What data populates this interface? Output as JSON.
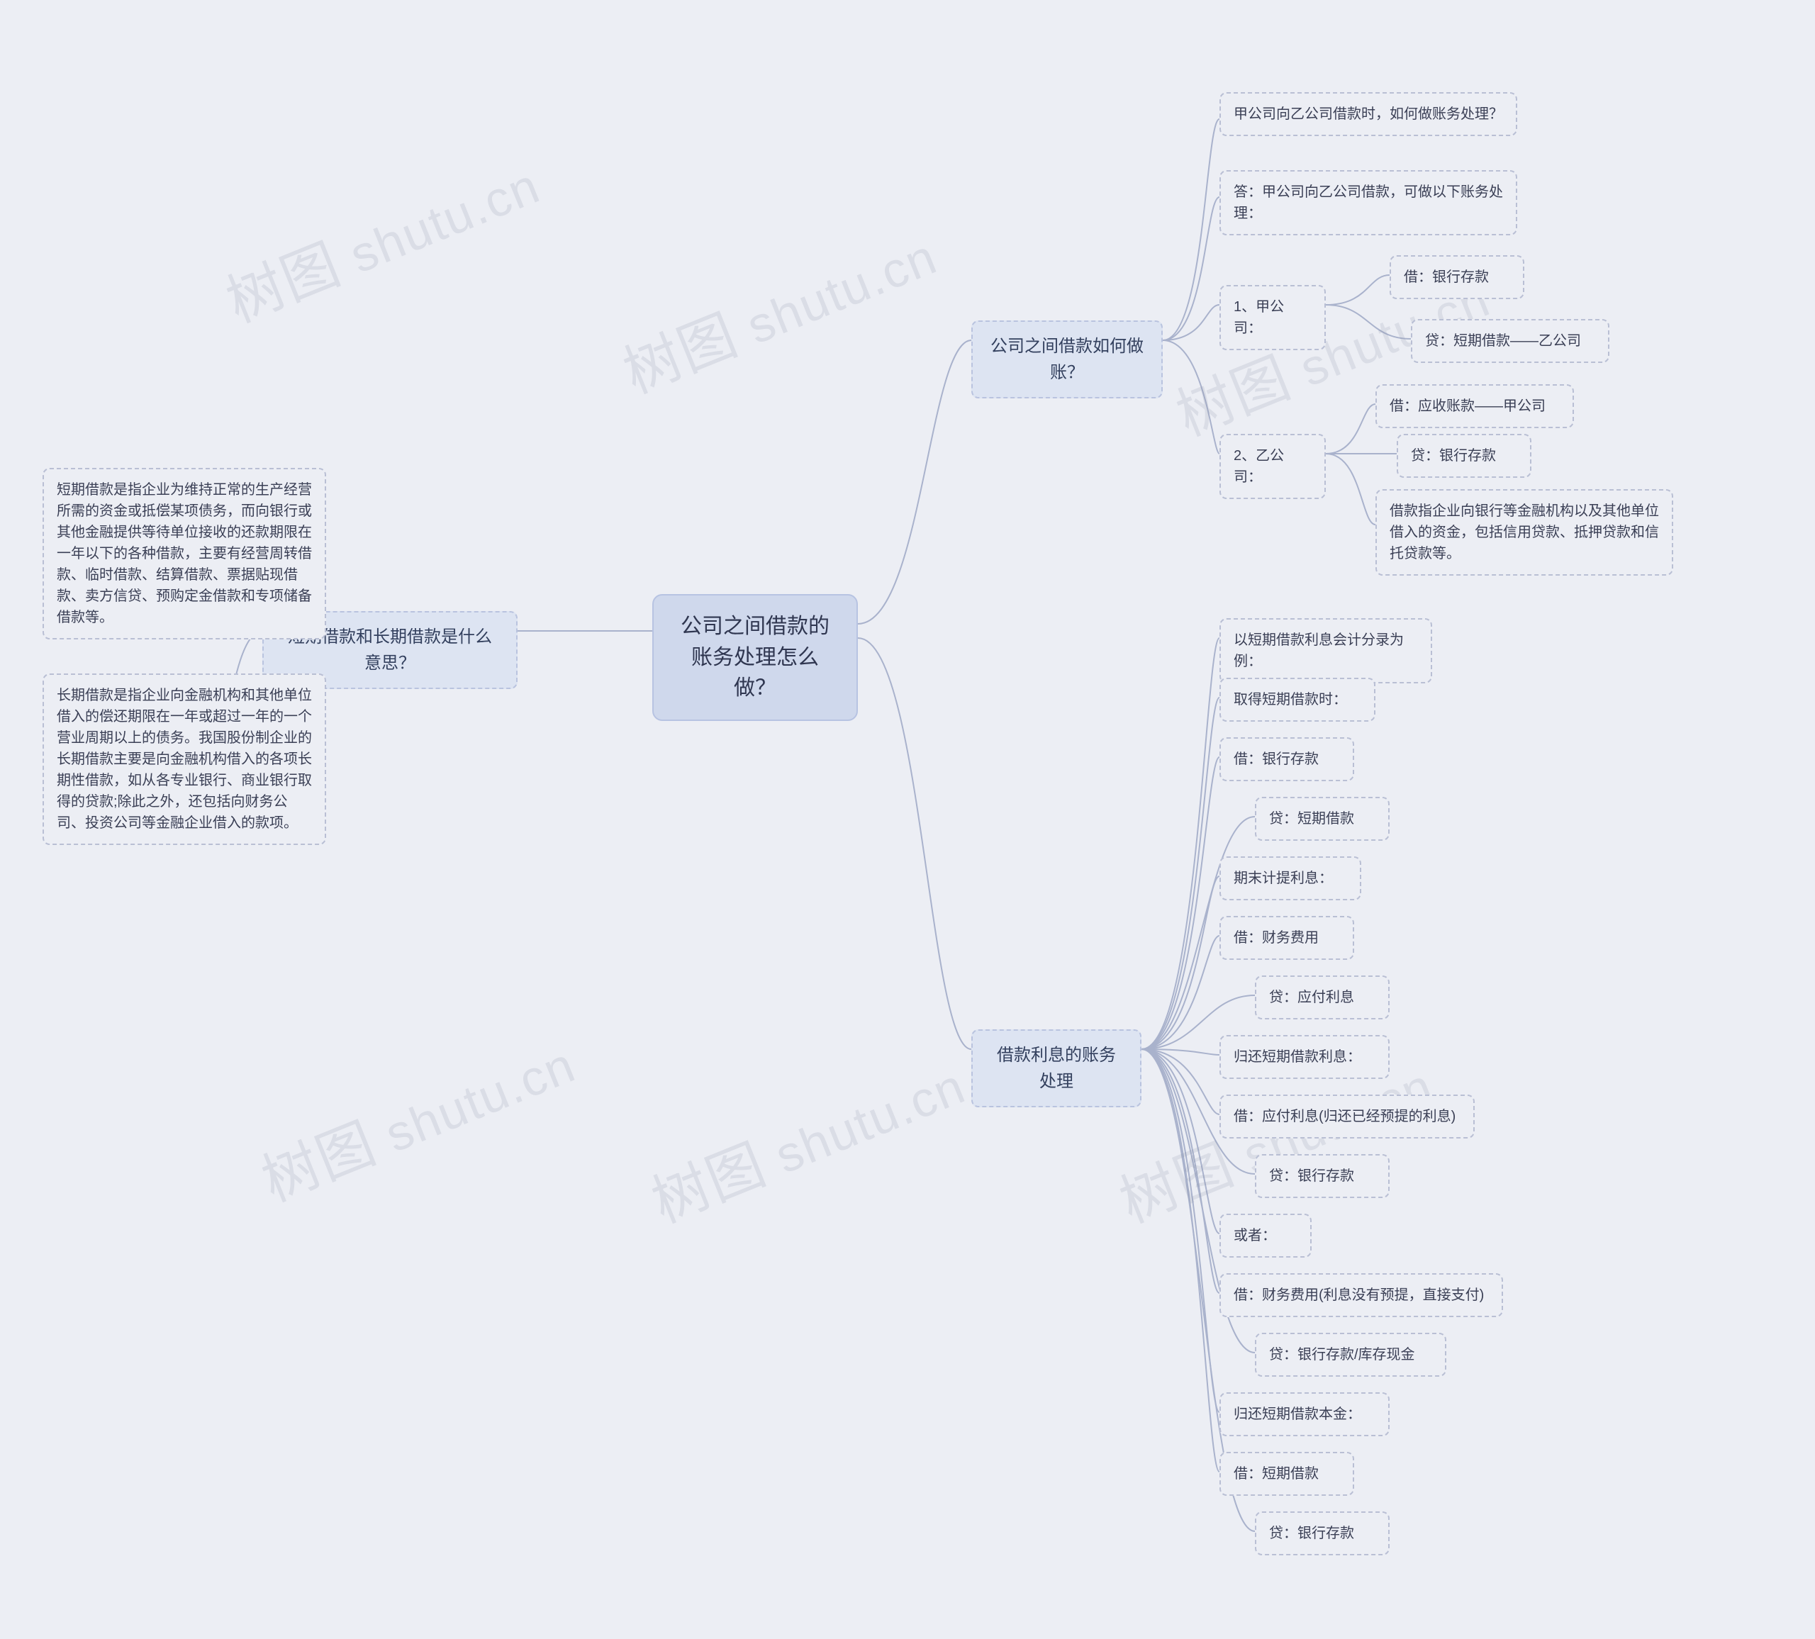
{
  "root": {
    "title": "公司之间借款的账务处理怎么做？"
  },
  "left": {
    "branch1": {
      "label": "短期借款和长期借款是什么意思？",
      "items": [
        "短期借款是指企业为维持正常的生产经营所需的资金或抵偿某项债务，而向银行或其他金融提供等待单位接收的还款期限在一年以下的各种借款，主要有经营周转借款、临时借款、结算借款、票据贴现借款、卖方信贷、预购定金借款和专项储备借款等。",
        "长期借款是指企业向金融机构和其他单位借入的偿还期限在一年或超过一年的一个营业周期以上的债务。我国股份制企业的长期借款主要是向金融机构借入的各项长期性借款，如从各专业银行、商业银行取得的贷款;除此之外，还包括向财务公司、投资公司等金融企业借入的款项。"
      ]
    }
  },
  "right": {
    "branch1": {
      "label": "公司之间借款如何做账？",
      "items": {
        "q": "甲公司向乙公司借款时，如何做账务处理？",
        "a": "答：甲公司向乙公司借款，可做以下账务处理：",
        "c1_label": "1、甲公司：",
        "c1_d": "借：银行存款",
        "c1_c": "贷：短期借款——乙公司",
        "c2_label": "2、乙公司：",
        "c2_d": "借：应收账款——甲公司",
        "c2_c": "贷：银行存款",
        "c2_n": "借款指企业向银行等金融机构以及其他单位借入的资金，包括信用贷款、抵押贷款和信托贷款等。"
      }
    },
    "branch2": {
      "label": "借款利息的账务处理",
      "items": [
        "以短期借款利息会计分录为例：",
        "取得短期借款时：",
        "借：银行存款",
        "贷：短期借款",
        "期末计提利息：",
        "借：财务费用",
        "贷：应付利息",
        "归还短期借款利息：",
        "借：应付利息(归还已经预提的利息)",
        "贷：银行存款",
        "或者：",
        "借：财务费用(利息没有预提，直接支付)",
        "贷：银行存款/库存现金",
        "归还短期借款本金：",
        "借：短期借款",
        "贷：银行存款"
      ]
    }
  },
  "watermark": "树图 shutu.cn"
}
